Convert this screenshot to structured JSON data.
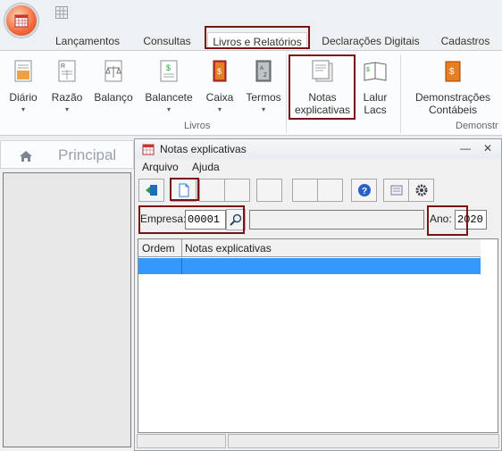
{
  "ribbon_tabs": [
    "Lançamentos",
    "Consultas",
    "Livros e Relatórios",
    "Declarações Digitais",
    "Cadastros"
  ],
  "ribbon_buttons": [
    {
      "label": "Diário"
    },
    {
      "label": "Razão"
    },
    {
      "label": "Balanço"
    },
    {
      "label": "Balancete"
    },
    {
      "label": "Caixa"
    },
    {
      "label": "Termos"
    },
    {
      "label": "Notas explicativas"
    },
    {
      "label": "Lalur Lacs"
    },
    {
      "label": "Demonstrações Contábeis"
    }
  ],
  "ribbon_groups": [
    "Livros",
    "Demonstr"
  ],
  "nav": {
    "title": "Principal"
  },
  "child_window": {
    "title": "Notas explicativas",
    "min_glyph": "—",
    "close_glyph": "✕",
    "menu": [
      "Arquivo",
      "Ajuda"
    ],
    "empresa_label": "Empresa:",
    "empresa_value": "00001",
    "ano_label": "Ano:",
    "ano_value": "2020",
    "grid_columns": [
      "Ordem",
      "Notas explicativas"
    ]
  },
  "colors": {
    "highlight": "#7b1216",
    "selection": "#3399ff",
    "orb": "#f26a3c"
  }
}
